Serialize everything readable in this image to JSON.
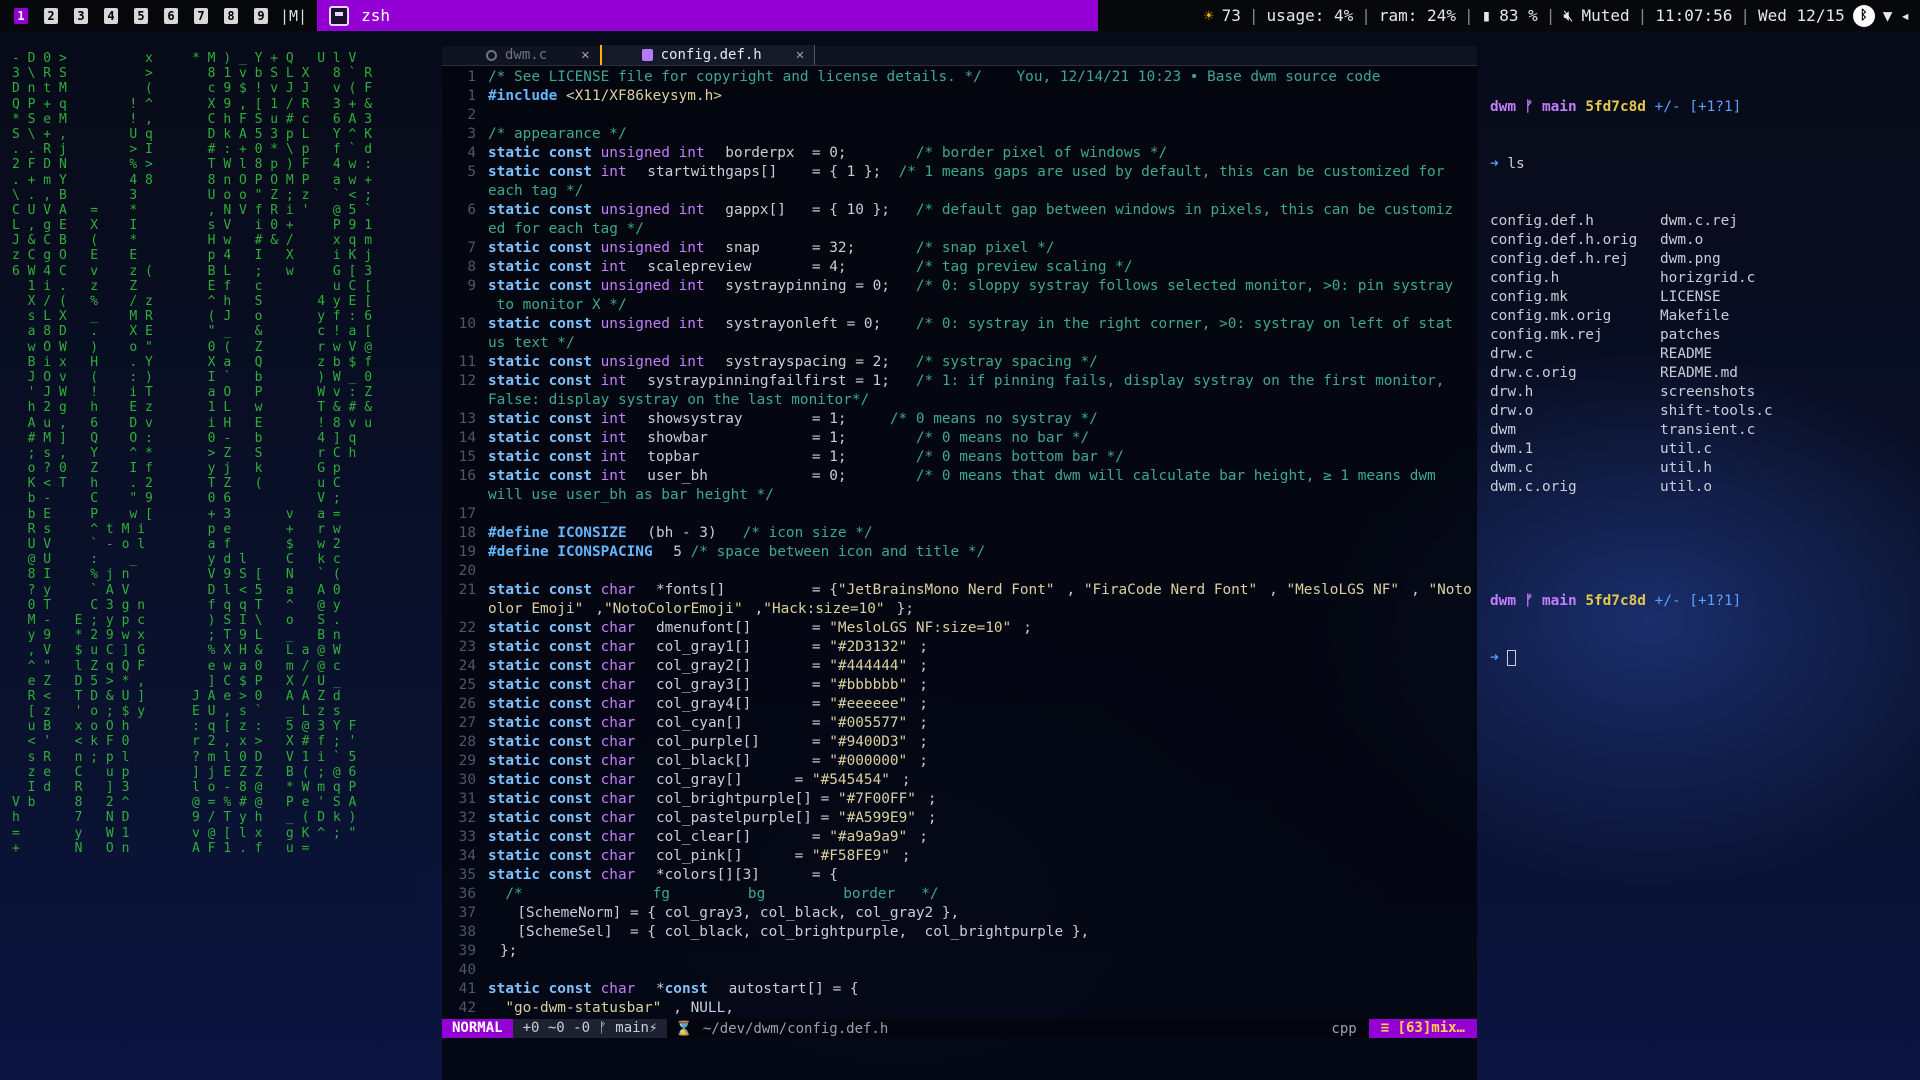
{
  "bar": {
    "tags": [
      "1",
      "2",
      "3",
      "4",
      "5",
      "6",
      "7",
      "8",
      "9"
    ],
    "active_tag": "1",
    "layout": "|M|",
    "window_title": "zsh",
    "brightness": "73",
    "usage": "usage: 4%",
    "ram": "ram: 24%",
    "battery": "83 %",
    "volume": "Muted",
    "time": "11:07:56",
    "date": "Wed 12/15"
  },
  "matrix": [
    "- D 0 >          x     * M ) _ Y + Q   U l V",
    "3 \\ R S          >       8 1 v b S L X   8 ` R",
    "D n t M          (       c 9 $ ! v J J   v ( F",
    "Q P + q        ! ^       X 9 , [ 1 / R   3 + &",
    "* S e M        ! ,       C h F S u # c   6 A 3",
    "S \\ + ,        U q       D k A 5 3 p L   Y ^ K",
    ". . R j        > I       # : + 0 * \\ p   f ` d",
    "2 F D N        % >       T W l 8 p ) F   4 w :",
    ". + m Y        4 8       8 n O P O M P   a w +",
    "\\ . , B        3         U o o \" Z ; z   ` < ;",
    "C U V A   =    *         , N V f R i '   @ 5 `",
    "L , g E   X    I         s V   i 0 +     P 9 1",
    "J & C B   (    *         H w   # & /     x q m",
    "z C g O   E    E         p 4   I   X     i K j",
    "6 W 4 C   v    z (       B L   ;   w     G [ 3",
    "  1 i .   z    Z         E f   c         u C [",
    "  X / (   %    / z       ^ h   S       4 y E [",
    "  s L X   _    M R       ( J   o       y f : 6",
    "  a 8 D   .    X E       \" _   &       c ! a [",
    "  w O W   )    o \"       0 (   Z       r w V @",
    "  B i x   H    . Y       X a   Q       z b $ f",
    "  J O v   (    : )       I `   b       ) W _ 0",
    "  ' J W   !    i T       a O   P       W v : Z",
    "  h 2 g   h    E z       1 L   w       T & # &",
    "  A u ,   6    D v       i H   E       ! 8 v u",
    "  # M ]   Q    O :       0 -   b       4 ] q",
    "  ; s ,   Y    ^ *       > Z   S       r C h",
    "  o ? 0   Z    I f       y j   k       G p",
    "  K < T   h    . 2       T Z   (       u C",
    "  b -     C    \" 9       0 6           V ;",
    "  b E     P    w [       + 3       v   a =",
    "  R s     ^ t M i        p e       +   r w",
    "  U V     ` - o l        a f       $   w 2",
    "  @ U     :    _         y d l     C   k c",
    "  8 I     % j n          V 9 S [   N   ` (",
    "  ? y     ` A V          D l < 5   a   A 0",
    "  0 T     C 3 g n        f q q T   ^   @ y",
    "  M -   E ; y p c        ) S I \\   o   S .",
    "  y 9   * 2 9 w x        ; T 9 L   _   B n",
    "  , V   $ u C ] G        % X H &   L a @ W",
    "  ^ \"   l Z q Q F        e w a 0   m / @ c",
    "  e Z   D 5 > * ,        ] C $ P   X / U _",
    "  R <   T D & U ]      J A e > 0   A A Z d",
    "  [ z   ' o ; $ y      E U , s `   _ L z s",
    "  u B   x o O h        : q [ z :   5 @ 3 Y F",
    "  < '   < k F 0        r 2 , x >   X # f ; '",
    "  s R   n ; p l        ? m l 0 D   V 1 i ` 5",
    "  z e   C   u p        ] j E Z Z   B ( ; @ 6",
    "  I d   R   ] 3        l o - 8 @   * W m q P",
    "V b     8   2 ^        @ = % # @   P e ' S A",
    "h       7   N D        9 / T y h   _ ( D k )",
    "=       y   W 1        v @ [ l x   g K ^ ; \"",
    "+       N   O n        A F 1 . f   u ="
  ],
  "editor": {
    "tabs": [
      {
        "label": "dwm.c",
        "active": false
      },
      {
        "label": "config.def.h",
        "active": true
      }
    ],
    "lines": [
      {
        "n": "1",
        "parts": [
          [
            "cm",
            "/* See LICENSE file for copyright and license details. */"
          ],
          [
            "blame",
            "    You, 12/14/21 10:23 • Base dwm source code"
          ]
        ]
      },
      {
        "n": "1",
        "parts": [
          [
            "pp",
            "#include "
          ],
          [
            "st",
            "<X11/XF86keysym.h>"
          ]
        ]
      },
      {
        "n": "2",
        "parts": []
      },
      {
        "n": "3",
        "parts": [
          [
            "cm",
            "/* appearance */"
          ]
        ]
      },
      {
        "n": "4",
        "parts": [
          [
            "kw",
            "static const "
          ],
          [
            "ty",
            "unsigned int "
          ],
          [
            "tx",
            "borderpx  = 0;        "
          ],
          [
            "cm",
            "/* border pixel of windows */"
          ]
        ]
      },
      {
        "n": "5",
        "parts": [
          [
            "kw",
            "static const "
          ],
          [
            "ty",
            "int "
          ],
          [
            "tx",
            "startwithgaps[]    = { 1 };  "
          ],
          [
            "cm",
            "/* 1 means gaps are used by default, this can be customized for"
          ]
        ]
      },
      {
        "n": "",
        "parts": [
          [
            "cm",
            "each tag */"
          ]
        ]
      },
      {
        "n": "6",
        "parts": [
          [
            "kw",
            "static const "
          ],
          [
            "ty",
            "unsigned int "
          ],
          [
            "tx",
            "gappx[]   = { 10 };   "
          ],
          [
            "cm",
            "/* default gap between windows in pixels, this can be customiz"
          ]
        ]
      },
      {
        "n": "",
        "parts": [
          [
            "cm",
            "ed for each tag */"
          ]
        ]
      },
      {
        "n": "7",
        "parts": [
          [
            "kw",
            "static const "
          ],
          [
            "ty",
            "unsigned int "
          ],
          [
            "tx",
            "snap      = 32;       "
          ],
          [
            "cm",
            "/* snap pixel */"
          ]
        ]
      },
      {
        "n": "8",
        "parts": [
          [
            "kw",
            "static const "
          ],
          [
            "ty",
            "int "
          ],
          [
            "tx",
            "scalepreview       = 4;        "
          ],
          [
            "cm",
            "/* tag preview scaling */"
          ]
        ]
      },
      {
        "n": "9",
        "parts": [
          [
            "kw",
            "static const "
          ],
          [
            "ty",
            "unsigned int "
          ],
          [
            "tx",
            "systraypinning = 0;   "
          ],
          [
            "cm",
            "/* 0: sloppy systray follows selected monitor, >0: pin systray"
          ]
        ]
      },
      {
        "n": "",
        "parts": [
          [
            "cm",
            " to monitor X */"
          ]
        ]
      },
      {
        "n": "10",
        "parts": [
          [
            "kw",
            "static const "
          ],
          [
            "ty",
            "unsigned int "
          ],
          [
            "tx",
            "systrayonleft = 0;    "
          ],
          [
            "cm",
            "/* 0: systray in the right corner, >0: systray on left of stat"
          ]
        ]
      },
      {
        "n": "",
        "parts": [
          [
            "cm",
            "us text */"
          ]
        ]
      },
      {
        "n": "11",
        "parts": [
          [
            "kw",
            "static const "
          ],
          [
            "ty",
            "unsigned int "
          ],
          [
            "tx",
            "systrayspacing = 2;   "
          ],
          [
            "cm",
            "/* systray spacing */"
          ]
        ]
      },
      {
        "n": "12",
        "parts": [
          [
            "kw",
            "static const "
          ],
          [
            "ty",
            "int "
          ],
          [
            "tx",
            "systraypinningfailfirst = 1;   "
          ],
          [
            "cm",
            "/* 1: if pinning fails, display systray on the first monitor,"
          ]
        ]
      },
      {
        "n": "",
        "parts": [
          [
            "cm",
            "False: display systray on the last monitor*/"
          ]
        ]
      },
      {
        "n": "13",
        "parts": [
          [
            "kw",
            "static const "
          ],
          [
            "ty",
            "int "
          ],
          [
            "tx",
            "showsystray        = 1;     "
          ],
          [
            "cm",
            "/* 0 means no systray */"
          ]
        ]
      },
      {
        "n": "14",
        "parts": [
          [
            "kw",
            "static const "
          ],
          [
            "ty",
            "int "
          ],
          [
            "tx",
            "showbar            = 1;        "
          ],
          [
            "cm",
            "/* 0 means no bar */"
          ]
        ]
      },
      {
        "n": "15",
        "parts": [
          [
            "kw",
            "static const "
          ],
          [
            "ty",
            "int "
          ],
          [
            "tx",
            "topbar             = 1;        "
          ],
          [
            "cm",
            "/* 0 means bottom bar */"
          ]
        ]
      },
      {
        "n": "16",
        "parts": [
          [
            "kw",
            "static const "
          ],
          [
            "ty",
            "int "
          ],
          [
            "tx",
            "user_bh            = 0;        "
          ],
          [
            "cm",
            "/* 0 means that dwm will calculate bar height, ≥ 1 means dwm"
          ]
        ]
      },
      {
        "n": "",
        "parts": [
          [
            "cm",
            "will use user_bh as bar height */"
          ]
        ]
      },
      {
        "n": "17",
        "parts": []
      },
      {
        "n": "18",
        "parts": [
          [
            "pp",
            "#define ICONSIZE "
          ],
          [
            "tx",
            "(bh - 3)   "
          ],
          [
            "cm",
            "/* icon size */"
          ]
        ]
      },
      {
        "n": "19",
        "parts": [
          [
            "pp",
            "#define ICONSPACING "
          ],
          [
            "tx",
            "5 "
          ],
          [
            "cm",
            "/* space between icon and title */"
          ]
        ]
      },
      {
        "n": "20",
        "parts": []
      },
      {
        "n": "21",
        "parts": [
          [
            "kw",
            "static const "
          ],
          [
            "ty",
            "char "
          ],
          [
            "tx",
            "*fonts[]          = {"
          ],
          [
            "st",
            "\"JetBrainsMono Nerd Font\""
          ],
          [
            "tx",
            ", "
          ],
          [
            "st",
            "\"FiraCode Nerd Font\""
          ],
          [
            "tx",
            ", "
          ],
          [
            "st",
            "\"MesloLGS NF\""
          ],
          [
            "tx",
            ", "
          ],
          [
            "st",
            "\"Noto C"
          ]
        ]
      },
      {
        "n": "",
        "parts": [
          [
            "st",
            "olor Emoji\""
          ],
          [
            "tx",
            ","
          ],
          [
            "st",
            "\"NotoColorEmoji\""
          ],
          [
            "tx",
            ","
          ],
          [
            "st",
            "\"Hack:size=10\""
          ],
          [
            "tx",
            "};"
          ]
        ]
      },
      {
        "n": "22",
        "parts": [
          [
            "kw",
            "static const "
          ],
          [
            "ty",
            "char "
          ],
          [
            "tx",
            "dmenufont[]       = "
          ],
          [
            "st",
            "\"MesloLGS NF:size=10\""
          ],
          [
            "tx",
            ";"
          ]
        ]
      },
      {
        "n": "23",
        "parts": [
          [
            "kw",
            "static const "
          ],
          [
            "ty",
            "char "
          ],
          [
            "tx",
            "col_gray1[]       = "
          ],
          [
            "st",
            "\"#2D3132\""
          ],
          [
            "tx",
            ";"
          ]
        ]
      },
      {
        "n": "24",
        "parts": [
          [
            "kw",
            "static const "
          ],
          [
            "ty",
            "char "
          ],
          [
            "tx",
            "col_gray2[]       = "
          ],
          [
            "st",
            "\"#444444\""
          ],
          [
            "tx",
            ";"
          ]
        ]
      },
      {
        "n": "25",
        "parts": [
          [
            "kw",
            "static const "
          ],
          [
            "ty",
            "char "
          ],
          [
            "tx",
            "col_gray3[]       = "
          ],
          [
            "st",
            "\"#bbbbbb\""
          ],
          [
            "tx",
            ";"
          ]
        ]
      },
      {
        "n": "26",
        "parts": [
          [
            "kw",
            "static const "
          ],
          [
            "ty",
            "char "
          ],
          [
            "tx",
            "col_gray4[]       = "
          ],
          [
            "st",
            "\"#eeeeee\""
          ],
          [
            "tx",
            ";"
          ]
        ]
      },
      {
        "n": "27",
        "parts": [
          [
            "kw",
            "static const "
          ],
          [
            "ty",
            "char "
          ],
          [
            "tx",
            "col_cyan[]        = "
          ],
          [
            "st",
            "\"#005577\""
          ],
          [
            "tx",
            ";"
          ]
        ]
      },
      {
        "n": "28",
        "parts": [
          [
            "kw",
            "static const "
          ],
          [
            "ty",
            "char "
          ],
          [
            "tx",
            "col_purple[]      = "
          ],
          [
            "st",
            "\"#9400D3\""
          ],
          [
            "tx",
            ";"
          ]
        ]
      },
      {
        "n": "29",
        "parts": [
          [
            "kw",
            "static const "
          ],
          [
            "ty",
            "char "
          ],
          [
            "tx",
            "col_black[]       = "
          ],
          [
            "st",
            "\"#000000\""
          ],
          [
            "tx",
            ";"
          ]
        ]
      },
      {
        "n": "30",
        "parts": [
          [
            "kw",
            "static const "
          ],
          [
            "ty",
            "char "
          ],
          [
            "tx",
            "col_gray[]      = "
          ],
          [
            "st",
            "\"#545454\""
          ],
          [
            "tx",
            ";"
          ]
        ]
      },
      {
        "n": "31",
        "parts": [
          [
            "kw",
            "static const "
          ],
          [
            "ty",
            "char "
          ],
          [
            "tx",
            "col_brightpurple[] = "
          ],
          [
            "st",
            "\"#7F00FF\""
          ],
          [
            "tx",
            ";"
          ]
        ]
      },
      {
        "n": "32",
        "parts": [
          [
            "kw",
            "static const "
          ],
          [
            "ty",
            "char "
          ],
          [
            "tx",
            "col_pastelpurple[] = "
          ],
          [
            "st",
            "\"#A599E9\""
          ],
          [
            "tx",
            ";"
          ]
        ]
      },
      {
        "n": "33",
        "parts": [
          [
            "kw",
            "static const "
          ],
          [
            "ty",
            "char "
          ],
          [
            "tx",
            "col_clear[]       = "
          ],
          [
            "st",
            "\"#a9a9a9\""
          ],
          [
            "tx",
            ";"
          ]
        ]
      },
      {
        "n": "34",
        "parts": [
          [
            "kw",
            "static const "
          ],
          [
            "ty",
            "char "
          ],
          [
            "tx",
            "col_pink[]      = "
          ],
          [
            "st",
            "\"#F58FE9\""
          ],
          [
            "tx",
            ";"
          ]
        ]
      },
      {
        "n": "35",
        "parts": [
          [
            "kw",
            "static const "
          ],
          [
            "ty",
            "char "
          ],
          [
            "tx",
            "*colors[][3]      = {"
          ]
        ]
      },
      {
        "n": "36",
        "parts": [
          [
            "cm",
            "  /*               fg         bg         border   */"
          ]
        ]
      },
      {
        "n": "37",
        "parts": [
          [
            "tx",
            "  [SchemeNorm] = { col_gray3, col_black, col_gray2 },"
          ]
        ]
      },
      {
        "n": "38",
        "parts": [
          [
            "tx",
            "  [SchemeSel]  = { col_black, col_brightpurple,  col_brightpurple },"
          ]
        ]
      },
      {
        "n": "39",
        "parts": [
          [
            "tx",
            "};"
          ]
        ]
      },
      {
        "n": "40",
        "parts": []
      },
      {
        "n": "41",
        "parts": [
          [
            "kw",
            "static const "
          ],
          [
            "ty",
            "char "
          ],
          [
            "tx",
            "*"
          ],
          [
            "kw",
            "const "
          ],
          [
            "tx",
            "autostart[] = {"
          ]
        ]
      },
      {
        "n": "42",
        "parts": [
          [
            "st",
            "  \"go-dwm-statusbar\""
          ],
          [
            "tx",
            ", NULL,"
          ]
        ]
      }
    ],
    "statusline": {
      "mode": "NORMAL",
      "git": "+0 ~0 -0 ᚠ main⚡",
      "path": "~/dev/dwm/config.def.h",
      "filetype": "cpp",
      "position": "≡ [63]mix…"
    }
  },
  "terminal": {
    "prompt_user": "dwm",
    "prompt_branch": "ᚠ main",
    "prompt_hash": "5fd7c8d",
    "prompt_status": "+/- [+1?1]",
    "command": "ls",
    "files": [
      "config.def.h",
      "dwm.c.rej",
      "config.def.h.orig",
      "dwm.o",
      "config.def.h.rej",
      "dwm.png",
      "config.h",
      "horizgrid.c",
      "config.mk",
      "LICENSE",
      "config.mk.orig",
      "Makefile",
      "config.mk.rej",
      "patches",
      "drw.c",
      "README",
      "drw.c.orig",
      "README.md",
      "drw.h",
      "screenshots",
      "drw.o",
      "shift-tools.c",
      "dwm",
      "transient.c",
      "dwm.1",
      "util.c",
      "dwm.c",
      "util.h",
      "dwm.c.orig",
      "util.o"
    ]
  },
  "colors": {
    "accent": "#9400d3",
    "matrix_green": "#2fae3a"
  }
}
